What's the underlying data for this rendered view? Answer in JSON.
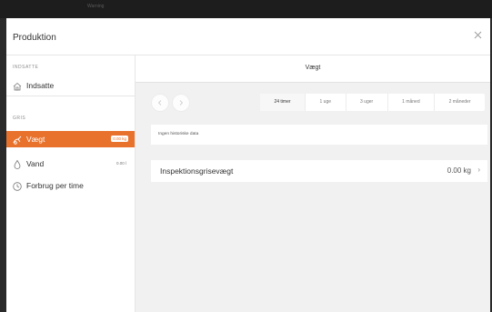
{
  "topbar": {
    "ghost_text": "Warning"
  },
  "header": {
    "title": "Produktion",
    "close_icon": "close-icon"
  },
  "sidebar": {
    "sections": [
      {
        "label": "INDSATTE"
      },
      {
        "label": "GRIS"
      }
    ],
    "items": [
      {
        "label": "Indsatte",
        "icon": "home-icon",
        "badge": ""
      },
      {
        "label": "Vægt",
        "icon": "weight-icon",
        "badge": "0.00 kg",
        "active": true
      },
      {
        "label": "Vand",
        "icon": "water-drop-icon",
        "badge": "0.00 l"
      },
      {
        "label": "Forbrug per time",
        "icon": "clock-icon",
        "badge": ""
      }
    ]
  },
  "main": {
    "title": "Vægt",
    "tabs": [
      {
        "label": "24 timer",
        "active": true
      },
      {
        "label": "1 uge"
      },
      {
        "label": "3 uger"
      },
      {
        "label": "1 måned"
      },
      {
        "label": "2 måneder"
      }
    ],
    "no_data_text": "Ingen historiske data",
    "inspection": {
      "label": "Inspektionsgrisevægt",
      "value": "0.00 kg",
      "chevron": "›"
    }
  },
  "colors": {
    "accent": "#e8722c",
    "background": "#f1f1f1",
    "topbar": "#1d1d1d"
  }
}
